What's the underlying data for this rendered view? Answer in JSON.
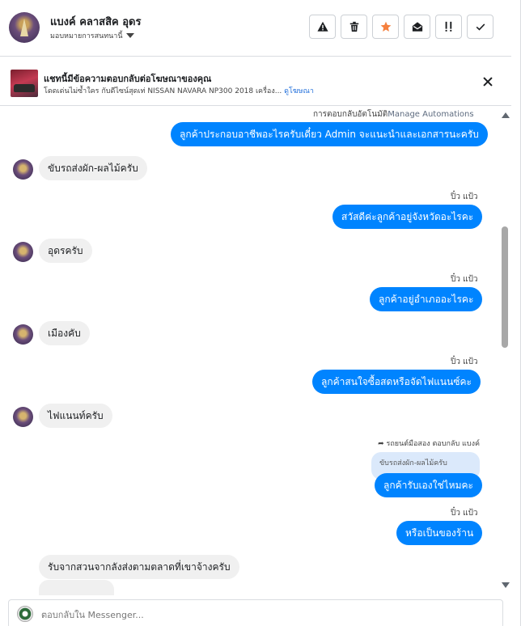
{
  "header": {
    "name": "แบงค์ คลาสสิค อุดร",
    "assign_label": "มอบหมายการสนทนานี้",
    "actions": [
      {
        "icon": "warning-icon",
        "name": "spam-button"
      },
      {
        "icon": "trash-icon",
        "name": "delete-button"
      },
      {
        "icon": "star-icon",
        "name": "star-button"
      },
      {
        "icon": "mark-unread-icon",
        "name": "mark-unread-button"
      },
      {
        "icon": "follow-up-icon",
        "name": "follow-up-button"
      },
      {
        "icon": "check-icon",
        "name": "done-button"
      }
    ],
    "star_color": "#f5803e"
  },
  "banner": {
    "title": "แชทนี้มีข้อความตอบกลับต่อโฆษณาของคุณ",
    "subtitle": "โดดเด่นไม่ซ้ำใคร กับดีไซน์สุดเท่ NISSAN NAVARA NP300 2018 เครื่อง...",
    "link": "ดูโฆษณา"
  },
  "thread": {
    "auto_reply_label": "การตอบกลับอัตโนมัติ",
    "manage_automations": "Manage Automations",
    "sender_label": "ปิ๋ว แป้ว",
    "reply_header": "รถยนต์มือสอง ตอบกลับ แบงค์",
    "reply_quote": "ขับรถส่งผัก-ผลไม้ครับ",
    "messages": [
      {
        "side": "out",
        "text": "ลูกค้าประกอบอาชีพอะไรครับเดี๋ยว Admin จะแนะนำและเอกสารนะครับ"
      },
      {
        "side": "in",
        "text": "ขับรถส่งผัก-ผลไม้ครับ"
      },
      {
        "side": "out",
        "text": "สวัสดีค่ะลูกค้าอยู่จังหวัดอะไรคะ"
      },
      {
        "side": "in",
        "text": "อุดรครับ"
      },
      {
        "side": "out",
        "text": "ลูกค้าอยู่อำเภออะไรคะ"
      },
      {
        "side": "in",
        "text": "เมืองคับ"
      },
      {
        "side": "out",
        "text": "ลูกค้าสนใจซื้อสดหรือจัดไฟแนนซ์คะ"
      },
      {
        "side": "in",
        "text": "ไฟแนนท์ครับ"
      },
      {
        "side": "out",
        "text": "ลูกค้ารับเองใช่ไหมคะ"
      },
      {
        "side": "out",
        "text": "หรือเป็นของร้าน"
      },
      {
        "side": "in",
        "text": "รับจากสวนจากลังส่งตามตลาดที่เขาจ้างครับ"
      }
    ]
  },
  "composer": {
    "placeholder": "ตอบกลับใน Messenger..."
  },
  "colors": {
    "outgoing_bubble": "#0084ff",
    "incoming_bubble": "#f0f0f0",
    "link": "#216fdb"
  }
}
